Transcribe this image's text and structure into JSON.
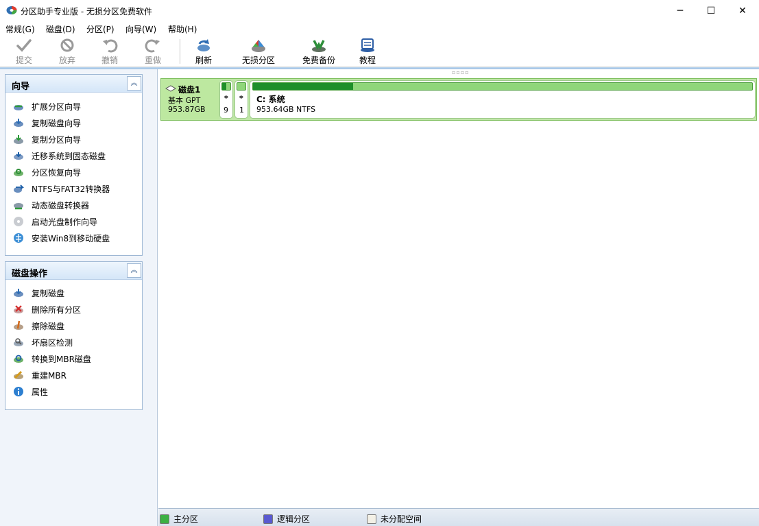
{
  "window": {
    "title": "分区助手专业版 - 无损分区免费软件",
    "minimize": "─",
    "maximize": "☐",
    "close": "✕"
  },
  "menu": [
    {
      "label": "常规(G)"
    },
    {
      "label": "磁盘(D)"
    },
    {
      "label": "分区(P)"
    },
    {
      "label": "向导(W)"
    },
    {
      "label": "帮助(H)"
    }
  ],
  "toolbar": {
    "commit": "提交",
    "discard": "放弃",
    "undo": "撤销",
    "redo": "重做",
    "refresh": "刷新",
    "lossless_partition": "无损分区",
    "free_backup": "免费备份",
    "tutorial": "教程"
  },
  "wizard_group": {
    "title": "向导",
    "items": [
      {
        "label": "扩展分区向导",
        "icon": "extend-partition-icon"
      },
      {
        "label": "复制磁盘向导",
        "icon": "copy-disk-icon"
      },
      {
        "label": "复制分区向导",
        "icon": "copy-partition-icon"
      },
      {
        "label": "迁移系统到固态磁盘",
        "icon": "migrate-os-icon"
      },
      {
        "label": "分区恢复向导",
        "icon": "partition-recovery-icon"
      },
      {
        "label": "NTFS与FAT32转换器",
        "icon": "ntfs-fat32-converter-icon"
      },
      {
        "label": "动态磁盘转换器",
        "icon": "dynamic-disk-converter-icon"
      },
      {
        "label": "启动光盘制作向导",
        "icon": "bootable-media-icon"
      },
      {
        "label": "安装Win8到移动硬盘",
        "icon": "windows-to-go-icon"
      }
    ]
  },
  "disk_ops_group": {
    "title": "磁盘操作",
    "items": [
      {
        "label": "复制磁盘",
        "icon": "copy-disk-icon"
      },
      {
        "label": "删除所有分区",
        "icon": "delete-partitions-icon"
      },
      {
        "label": "擦除磁盘",
        "icon": "wipe-disk-icon"
      },
      {
        "label": "坏扇区检测",
        "icon": "bad-sector-icon"
      },
      {
        "label": "转换到MBR磁盘",
        "icon": "convert-mbr-icon"
      },
      {
        "label": "重建MBR",
        "icon": "rebuild-mbr-icon"
      },
      {
        "label": "属性",
        "icon": "properties-icon"
      }
    ]
  },
  "disk": {
    "name": "磁盘1",
    "type": "基本 GPT",
    "size": "953.87GB",
    "partitions": [
      {
        "star": "*",
        "num": "9",
        "used_fraction": 0.5
      },
      {
        "star": "*",
        "num": "1",
        "used_fraction": 0.0
      },
      {
        "name": "C: 系统",
        "info": "953.64GB NTFS",
        "used_fraction": 0.2
      }
    ]
  },
  "legend": {
    "primary": "主分区",
    "logical": "逻辑分区",
    "unallocated": "未分配空间",
    "colors": {
      "primary": "#3cb043",
      "logical": "#5a5ad0",
      "unallocated": "#f3f0e6"
    }
  }
}
